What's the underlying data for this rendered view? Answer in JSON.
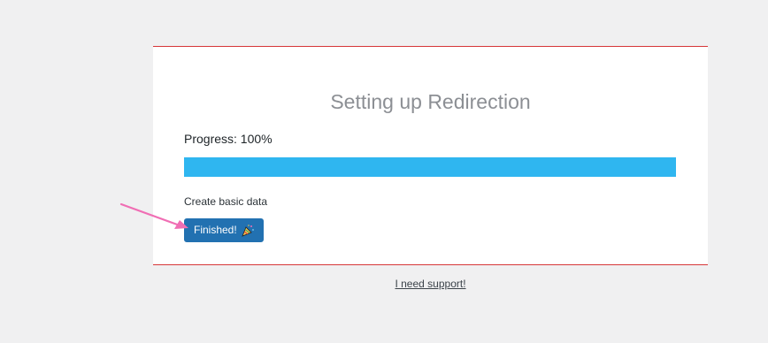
{
  "wizard": {
    "title": "Setting up Redirection",
    "progress_label": "Progress: 100%",
    "progress_percent": 100,
    "step_text": "Create basic data",
    "finish_button_label": "Finished!",
    "finish_icon": "party-popper-icon"
  },
  "footer": {
    "support_link": "I need support!"
  },
  "colors": {
    "accent_border": "#d63638",
    "progress_fill": "#2fb6f0",
    "button_bg": "#2271b1",
    "annotation_arrow": "#f06eb4"
  }
}
